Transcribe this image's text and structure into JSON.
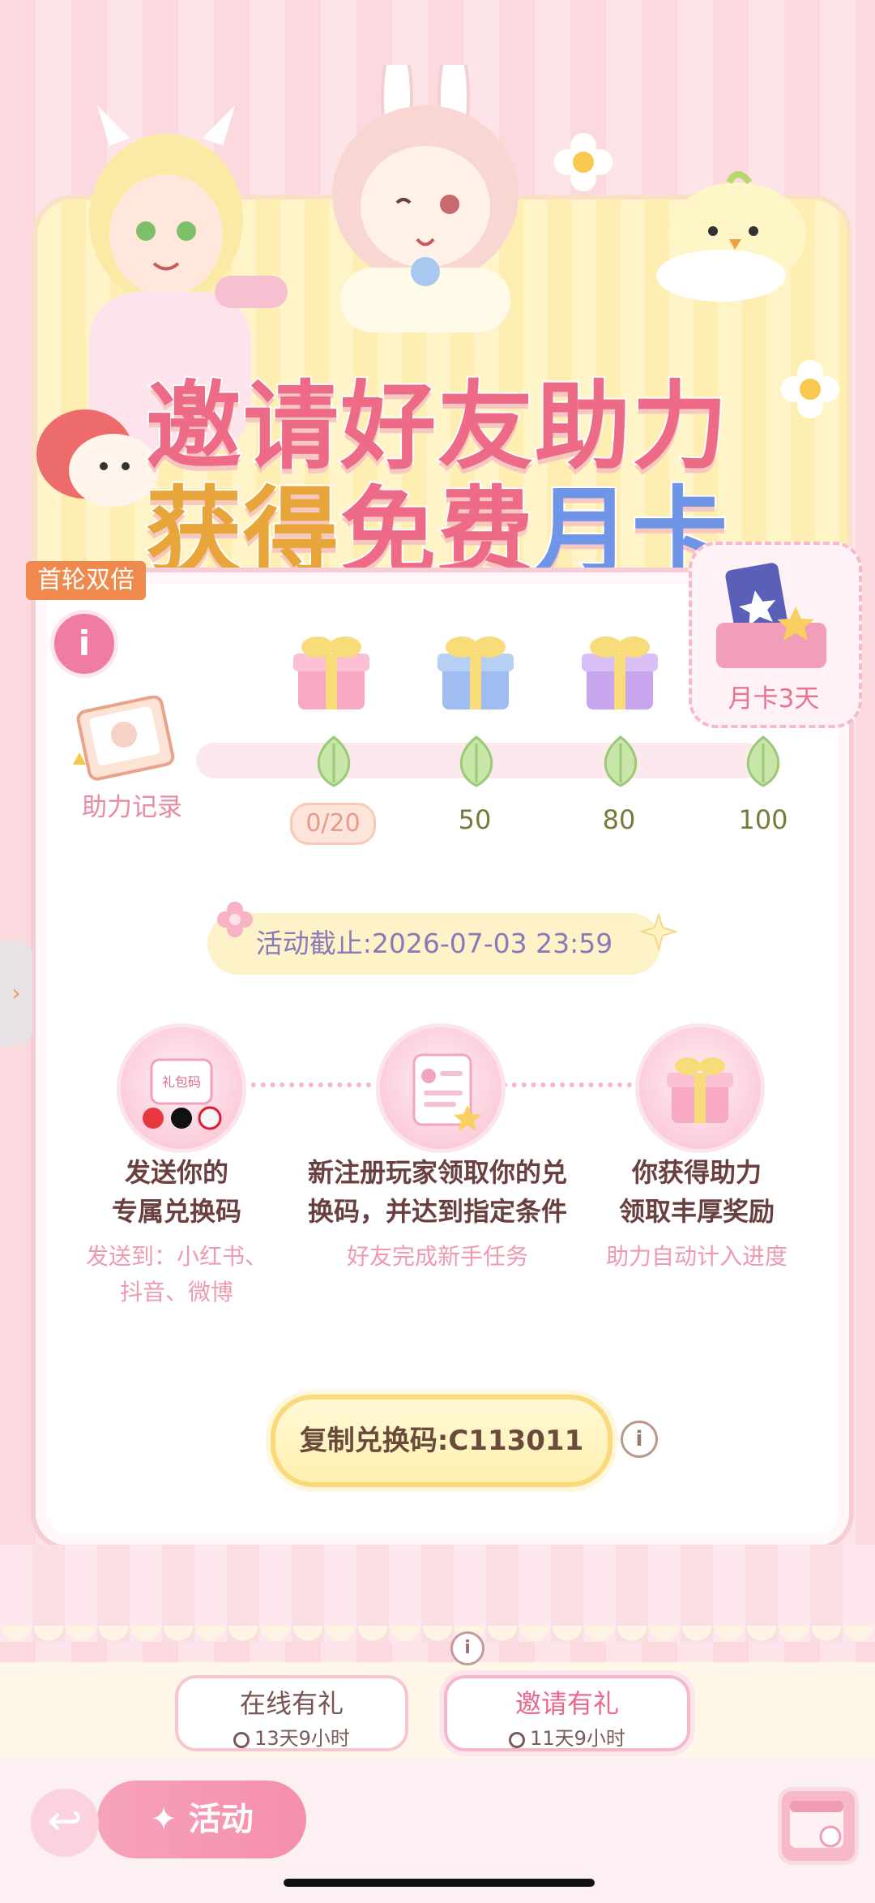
{
  "banner": {
    "title_line1": "邀请好友助力",
    "title_line2_part1": "获得",
    "title_line2_part2": "免费",
    "title_line2_part3": "月卡"
  },
  "badge_first_round": "首轮双倍",
  "info_icon": "i",
  "record": {
    "label": "助力记录"
  },
  "progress": {
    "current": "0/20",
    "current_value": 0,
    "milestones": [
      "50",
      "80",
      "100"
    ],
    "reward_label": "月卡3天"
  },
  "deadline": "活动截止:2026-07-03 23:59",
  "steps": [
    {
      "title_line1": "发送你的",
      "title_line2": "专属兑换码",
      "sub_line1": "发送到：小红书、",
      "sub_line2": "抖音、微博",
      "icon_text": "礼包码"
    },
    {
      "title_line1": "新注册玩家领取你的兑",
      "title_line2": "换码，并达到指定条件",
      "sub_line1": "好友完成新手任务",
      "sub_line2": ""
    },
    {
      "title_line1": "你获得助力",
      "title_line2": "领取丰厚奖励",
      "sub_line1": "助力自动计入进度",
      "sub_line2": ""
    }
  ],
  "copy_button": "复制兑换码:C113011",
  "tabs": [
    {
      "title": "在线有礼",
      "time": "13天9小时"
    },
    {
      "title": "邀请有礼",
      "time": "11天9小时"
    }
  ],
  "footer": {
    "activity_label": "活动"
  },
  "colors": {
    "accent_pink": "#ee6b87",
    "accent_yellow": "#e8a63a",
    "accent_blue": "#6f95e8"
  },
  "icons": [
    "info-icon",
    "record-book-icon",
    "gift-icon",
    "leaf-icon",
    "clock-icon",
    "back-arrow-icon",
    "calendar-icon",
    "sparkle-icon"
  ]
}
